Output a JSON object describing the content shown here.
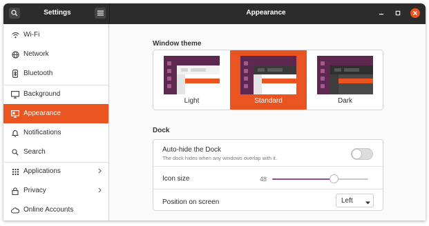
{
  "header": {
    "sidebar_title": "Settings",
    "title": "Appearance",
    "buttons": {
      "search": "search-icon",
      "menu": "hamburger-menu-icon",
      "minimize": "minimize-icon",
      "maximize": "maximize-icon",
      "close": "close-icon"
    }
  },
  "sidebar": {
    "items": [
      {
        "label": "Wi-Fi",
        "icon": "wifi-icon",
        "active": false
      },
      {
        "label": "Network",
        "icon": "network-icon",
        "active": false
      },
      {
        "label": "Bluetooth",
        "icon": "bluetooth-icon",
        "active": false
      },
      {
        "label": "Background",
        "icon": "background-icon",
        "active": false
      },
      {
        "label": "Appearance",
        "icon": "appearance-icon",
        "active": true
      },
      {
        "label": "Notifications",
        "icon": "bell-icon",
        "active": false
      },
      {
        "label": "Search",
        "icon": "search-icon",
        "active": false
      },
      {
        "label": "Applications",
        "icon": "apps-grid-icon",
        "active": false,
        "has_submenu": true
      },
      {
        "label": "Privacy",
        "icon": "lock-icon",
        "active": false,
        "has_submenu": true
      },
      {
        "label": "Online Accounts",
        "icon": "cloud-icon",
        "active": false
      }
    ]
  },
  "main": {
    "window_theme": {
      "title": "Window theme",
      "options": [
        {
          "label": "Light",
          "selected": false
        },
        {
          "label": "Standard",
          "selected": true
        },
        {
          "label": "Dark",
          "selected": false
        }
      ]
    },
    "dock": {
      "title": "Dock",
      "autohide": {
        "label": "Auto-hide the Dock",
        "description": "The dock hides when any windows overlap with it.",
        "enabled": false
      },
      "icon_size": {
        "label": "Icon size",
        "value": "48",
        "fraction": 0.66
      },
      "position": {
        "label": "Position on screen",
        "value": "Left"
      }
    }
  },
  "colors": {
    "accent": "#e95420",
    "header": "#2c2c2c",
    "slider": "#924d8b",
    "aubergine": "#5e2750"
  }
}
